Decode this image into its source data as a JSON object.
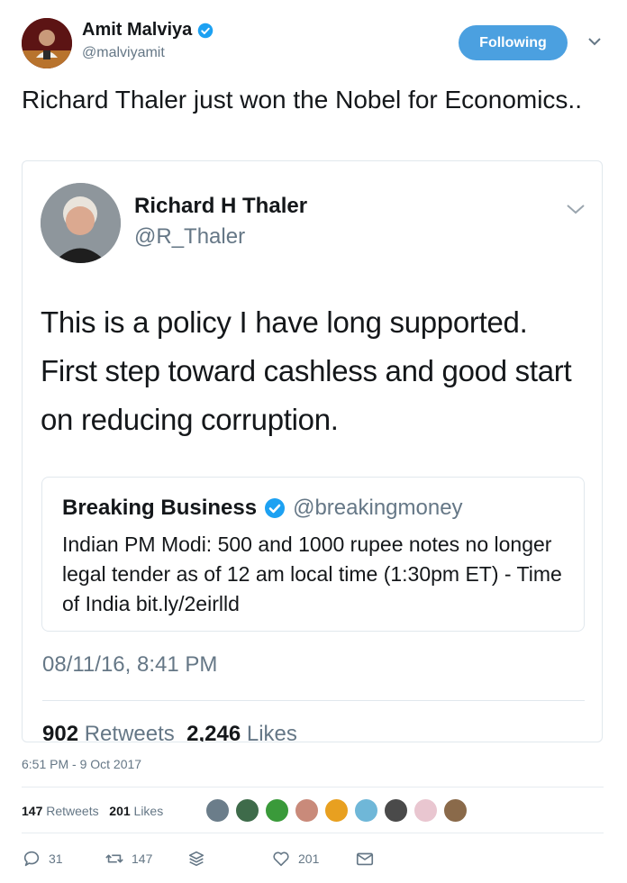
{
  "author": {
    "display_name": "Amit Malviya",
    "handle": "@malviyamit",
    "verified": true,
    "avatar_icon": "user-avatar-icon"
  },
  "follow_button": {
    "label": "Following",
    "color": "#4ba0e0"
  },
  "tweet": {
    "text": "Richard Thaler just won the Nobel for Economics.."
  },
  "quoted_tweet": {
    "display_name": "Richard H Thaler",
    "handle": "@R_Thaler",
    "text": "This is a policy I have long supported. First step toward cashless and good start on reducing corruption.",
    "timestamp": "08/11/16, 8:41 PM",
    "retweets_count": "902",
    "retweets_label": "Retweets",
    "likes_count": "2,246",
    "likes_label": "Likes",
    "inner_quote": {
      "display_name": "Breaking Business",
      "handle": "@breakingmoney",
      "verified": true,
      "text": "Indian PM Modi: 500 and 1000 rupee notes no longer legal tender as of 12 am local time (1:30pm ET) - Time of India bit.ly/2eirlld"
    }
  },
  "timestamp": "6:51 PM - 9 Oct 2017",
  "stats": {
    "retweets_count": "147",
    "retweets_label": "Retweets",
    "likes_count": "201",
    "likes_label": "Likes"
  },
  "actions": {
    "reply_count": "31",
    "retweet_count": "147",
    "like_count": "201"
  },
  "colors": {
    "accent": "#1da1f2",
    "muted": "#657786"
  }
}
